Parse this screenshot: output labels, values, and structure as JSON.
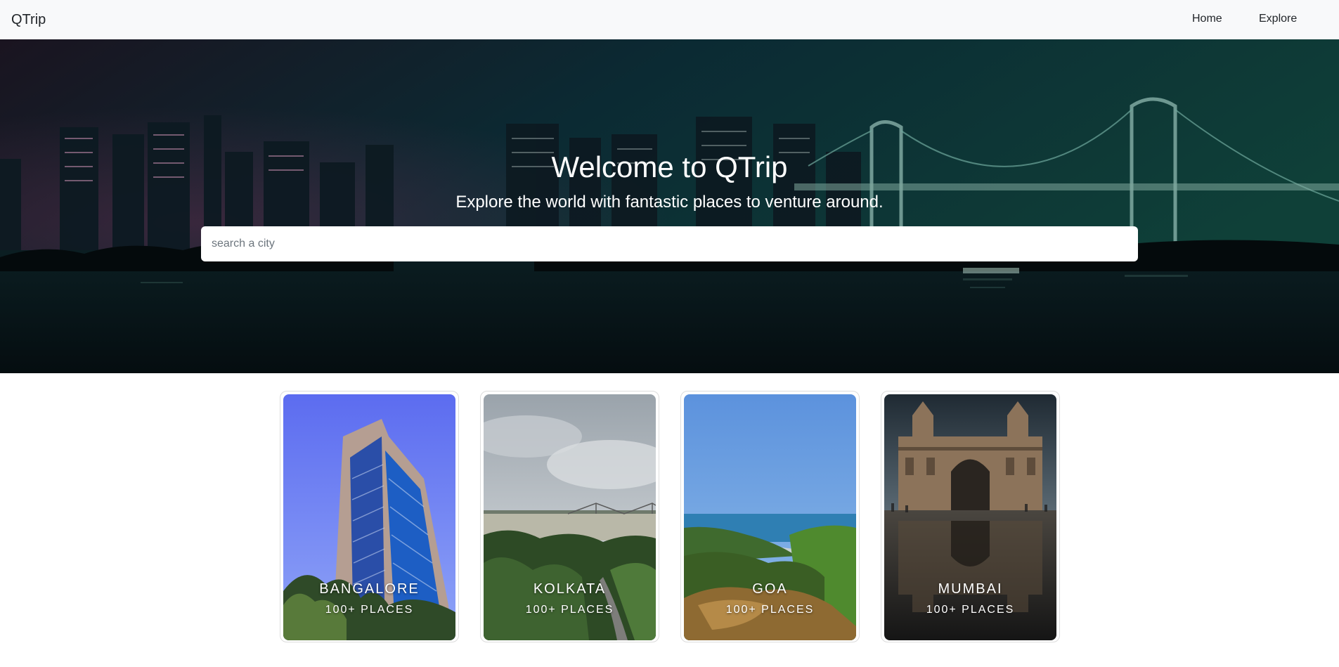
{
  "navbar": {
    "brand": "QTrip",
    "links": [
      {
        "label": "Home"
      },
      {
        "label": "Explore"
      }
    ]
  },
  "hero": {
    "title": "Welcome to QTrip",
    "subtitle": "Explore the world with fantastic places to venture around.",
    "search": {
      "placeholder": "search a city",
      "value": ""
    }
  },
  "cities": [
    {
      "name": "Bangalore",
      "places": "100+ Places"
    },
    {
      "name": "Kolkata",
      "places": "100+ Places"
    },
    {
      "name": "Goa",
      "places": "100+ Places"
    },
    {
      "name": "Mumbai",
      "places": "100+ Places"
    }
  ],
  "colors": {
    "navbar_bg": "#f8f9fa",
    "hero_tint": "#0c3a3a",
    "text_white": "#ffffff"
  }
}
